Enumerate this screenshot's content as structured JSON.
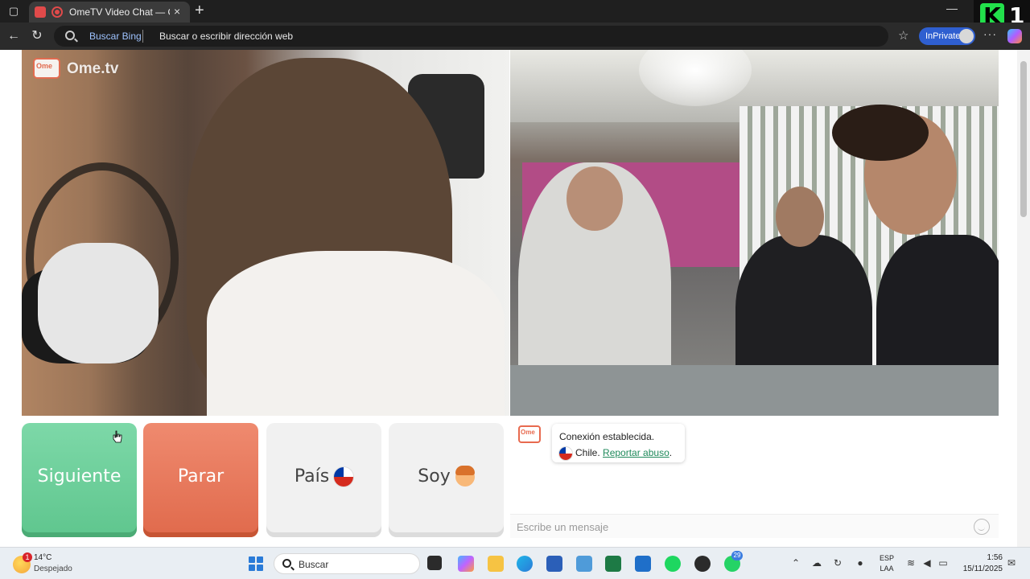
{
  "browser": {
    "tab_title": "OmeTV Video Chat — Omegle",
    "tab_close": "×",
    "new_tab": "+",
    "address": {
      "engine_label": "Buscar Bing",
      "placeholder": "Buscar o escribir dirección web"
    },
    "inprivate_label": "InPrivate",
    "more_label": "···",
    "overlay_badge": {
      "letter": "K",
      "number": "1"
    }
  },
  "page": {
    "logo_text": "Ome.tv",
    "buttons": {
      "next": "Siguiente",
      "stop": "Parar",
      "country": "País",
      "gender": "Soy"
    },
    "chat": {
      "status": "Conexión establecida.",
      "country": "Chile.",
      "report_link": "Reportar abuso",
      "report_suffix": ".",
      "input_placeholder": "Escribe un mensaje"
    }
  },
  "taskbar": {
    "weather": {
      "temp": "14°C",
      "condition": "Despejado",
      "badge": "1"
    },
    "search_label": "Buscar",
    "whatsapp_badge": "29",
    "language": {
      "line1": "ESP",
      "line2": "LAA"
    },
    "clock": {
      "time": "1:56",
      "date": "15/11/2025"
    }
  },
  "colors": {
    "next_button": "#6bcf99",
    "stop_button": "#e7765a",
    "neutral_button": "#f1f1f1",
    "report_link": "#1f8a5b",
    "inprivate": "#2f5fd0"
  }
}
